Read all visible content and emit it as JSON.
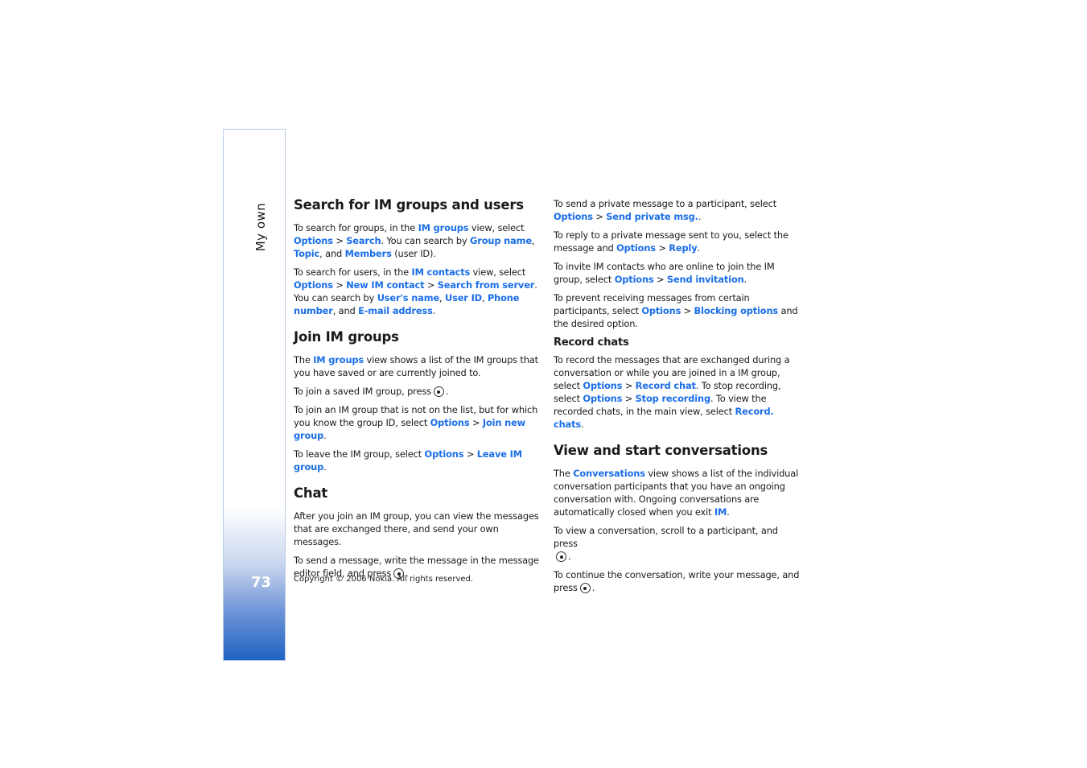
{
  "sidebar": {
    "section_label": "My own",
    "page_number": "73"
  },
  "footer": {
    "copyright": "Copyright © 2006 Nokia. All rights reserved."
  },
  "links": {
    "im_groups": "IM groups",
    "options": "Options",
    "search": "Search",
    "group_name": "Group name",
    "topic": "Topic",
    "members": "Members",
    "im_contacts": "IM contacts",
    "new_im_contact": "New IM contact",
    "search_from_server": "Search from server",
    "users_name": "User's name",
    "user_id": "User ID",
    "phone_number": "Phone number",
    "email_address": "E-mail address",
    "join_new_group": "Join new group",
    "leave_im_group": "Leave IM group",
    "send_private_msg": "Send private msg.",
    "reply": "Reply",
    "send_invitation": "Send invitation",
    "blocking_options": "Blocking options",
    "record_chat": "Record chat",
    "stop_recording": "Stop recording",
    "record_chats": "Record. chats",
    "conversations": "Conversations",
    "im": "IM"
  },
  "sections": {
    "search": {
      "heading": "Search for IM groups and users",
      "p1": [
        "To search for groups, in the ",
        " view, select ",
        " > ",
        ". You can search by ",
        ", ",
        ",",
        "and ",
        " (user ID)."
      ],
      "p2": [
        "To search for users, in the ",
        " view, select ",
        " > ",
        " > ",
        ". You can search by ",
        ", ",
        ", ",
        ", and ",
        "."
      ]
    },
    "join": {
      "heading": "Join IM groups",
      "p1": [
        "The ",
        " view shows a list of the IM groups that you have saved or are currently joined to."
      ],
      "p2": [
        "To join a saved IM group, press",
        "."
      ],
      "p3": [
        "To join an IM group that is not on the list, but for which you know the group ID, select ",
        " > ",
        "."
      ],
      "p4": [
        "To leave the IM group, select ",
        " > ",
        "."
      ]
    },
    "chat": {
      "heading": "Chat",
      "p1": "After you join an IM group, you can view the messages that are exchanged there, and send your own messages.",
      "p2": [
        "To send a message, write the message in the message editor field, and press",
        "."
      ],
      "p3": [
        "To send a private message to a participant, select ",
        " > ",
        "."
      ],
      "p4": [
        "To reply to a private message sent to you, select the message and ",
        " > ",
        "."
      ],
      "p5": [
        "To invite IM contacts who are online to join the IM group, select ",
        " > ",
        "."
      ],
      "p6": [
        "To prevent receiving messages from certain participants, select ",
        " > ",
        " and the desired option."
      ]
    },
    "record": {
      "heading": "Record chats",
      "p1": [
        "To record the messages that are exchanged during a conversation or while you are joined in a IM group, select ",
        " > ",
        ". To stop recording, select ",
        " > ",
        ". To view the recorded chats, in the main view, select ",
        "."
      ]
    },
    "conversations": {
      "heading": "View and start conversations",
      "p1": [
        "The ",
        " view shows a list of the individual conversation participants that you have an ongoing conversation with. Ongoing conversations are automatically closed when you exit ",
        "."
      ],
      "p2": [
        "To view a conversation, scroll to a participant, and press",
        "."
      ],
      "p3": [
        "To continue the conversation, write your message, and press",
        "."
      ]
    }
  },
  "icons": {
    "selection_key": "select-key-icon"
  },
  "colors": {
    "link": "#1a6ee8",
    "sidebar_gradient_bottom": "#1f63c3"
  }
}
